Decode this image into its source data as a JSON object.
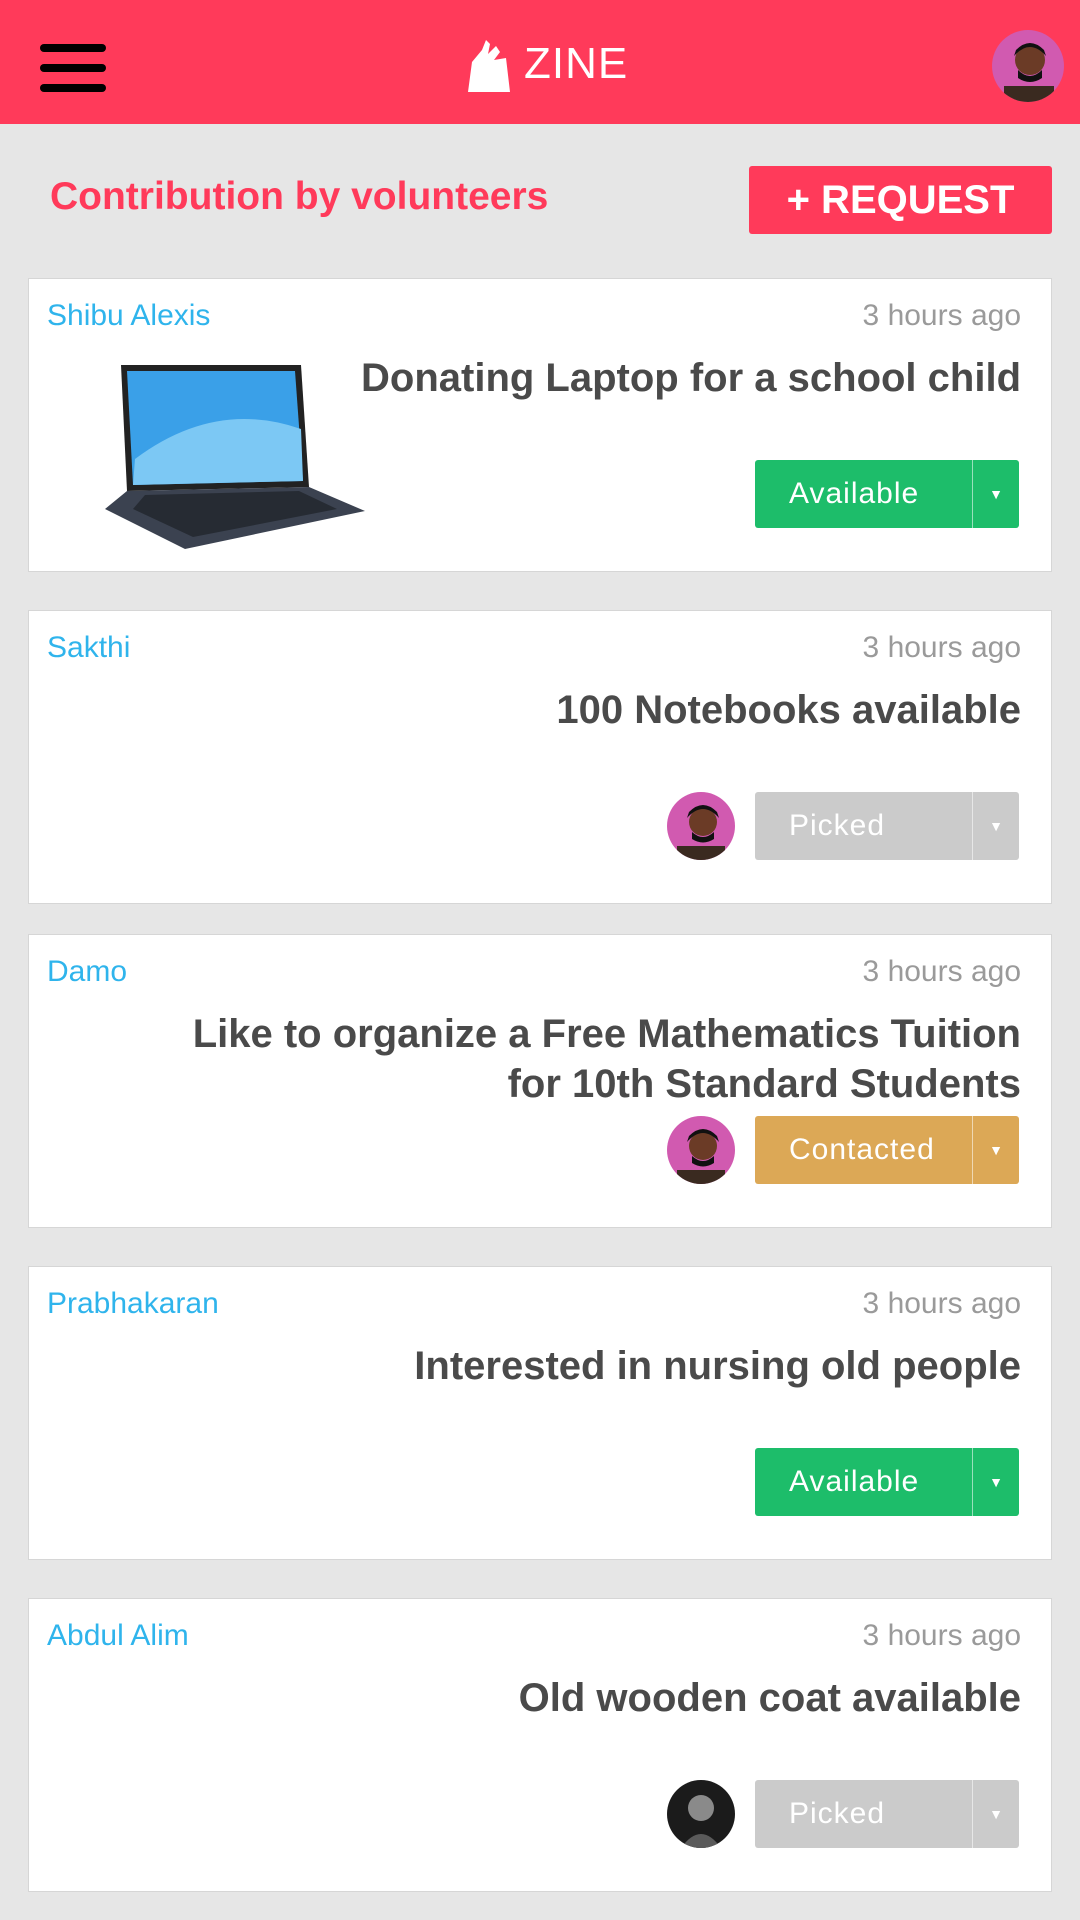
{
  "header": {
    "brand_name": "ZINE",
    "accent_color": "#ff3a5a"
  },
  "section": {
    "title": "Contribution by volunteers",
    "request_label": "+ REQUEST"
  },
  "cards": [
    {
      "author": "Shibu  Alexis",
      "time": "3  hours  ago",
      "title": "Donating Laptop for a school child",
      "status": "Available",
      "status_color": "#1dbd6a",
      "thumbnail": "laptop-image"
    },
    {
      "author": "Sakthi",
      "time": "3  hours  ago",
      "title": "100 Notebooks available",
      "status": "Picked",
      "status_color": "#cbcbcb",
      "assignee_avatar": "avatar-pink"
    },
    {
      "author": "Damo",
      "time": "3  hours  ago",
      "title": "Like to organize a Free Mathematics Tuition for 10th Standard Students",
      "status": "Contacted",
      "status_color": "#dca856",
      "assignee_avatar": "avatar-pink"
    },
    {
      "author": "Prabhakaran",
      "time": "3  hours  ago",
      "title": "Interested in nursing old people",
      "status": "Available",
      "status_color": "#1dbd6a"
    },
    {
      "author": "Abdul  Alim",
      "time": "3  hours  ago",
      "title": "Old wooden coat available",
      "status": "Picked",
      "status_color": "#cbcbcb",
      "assignee_avatar": "avatar-dark"
    }
  ]
}
